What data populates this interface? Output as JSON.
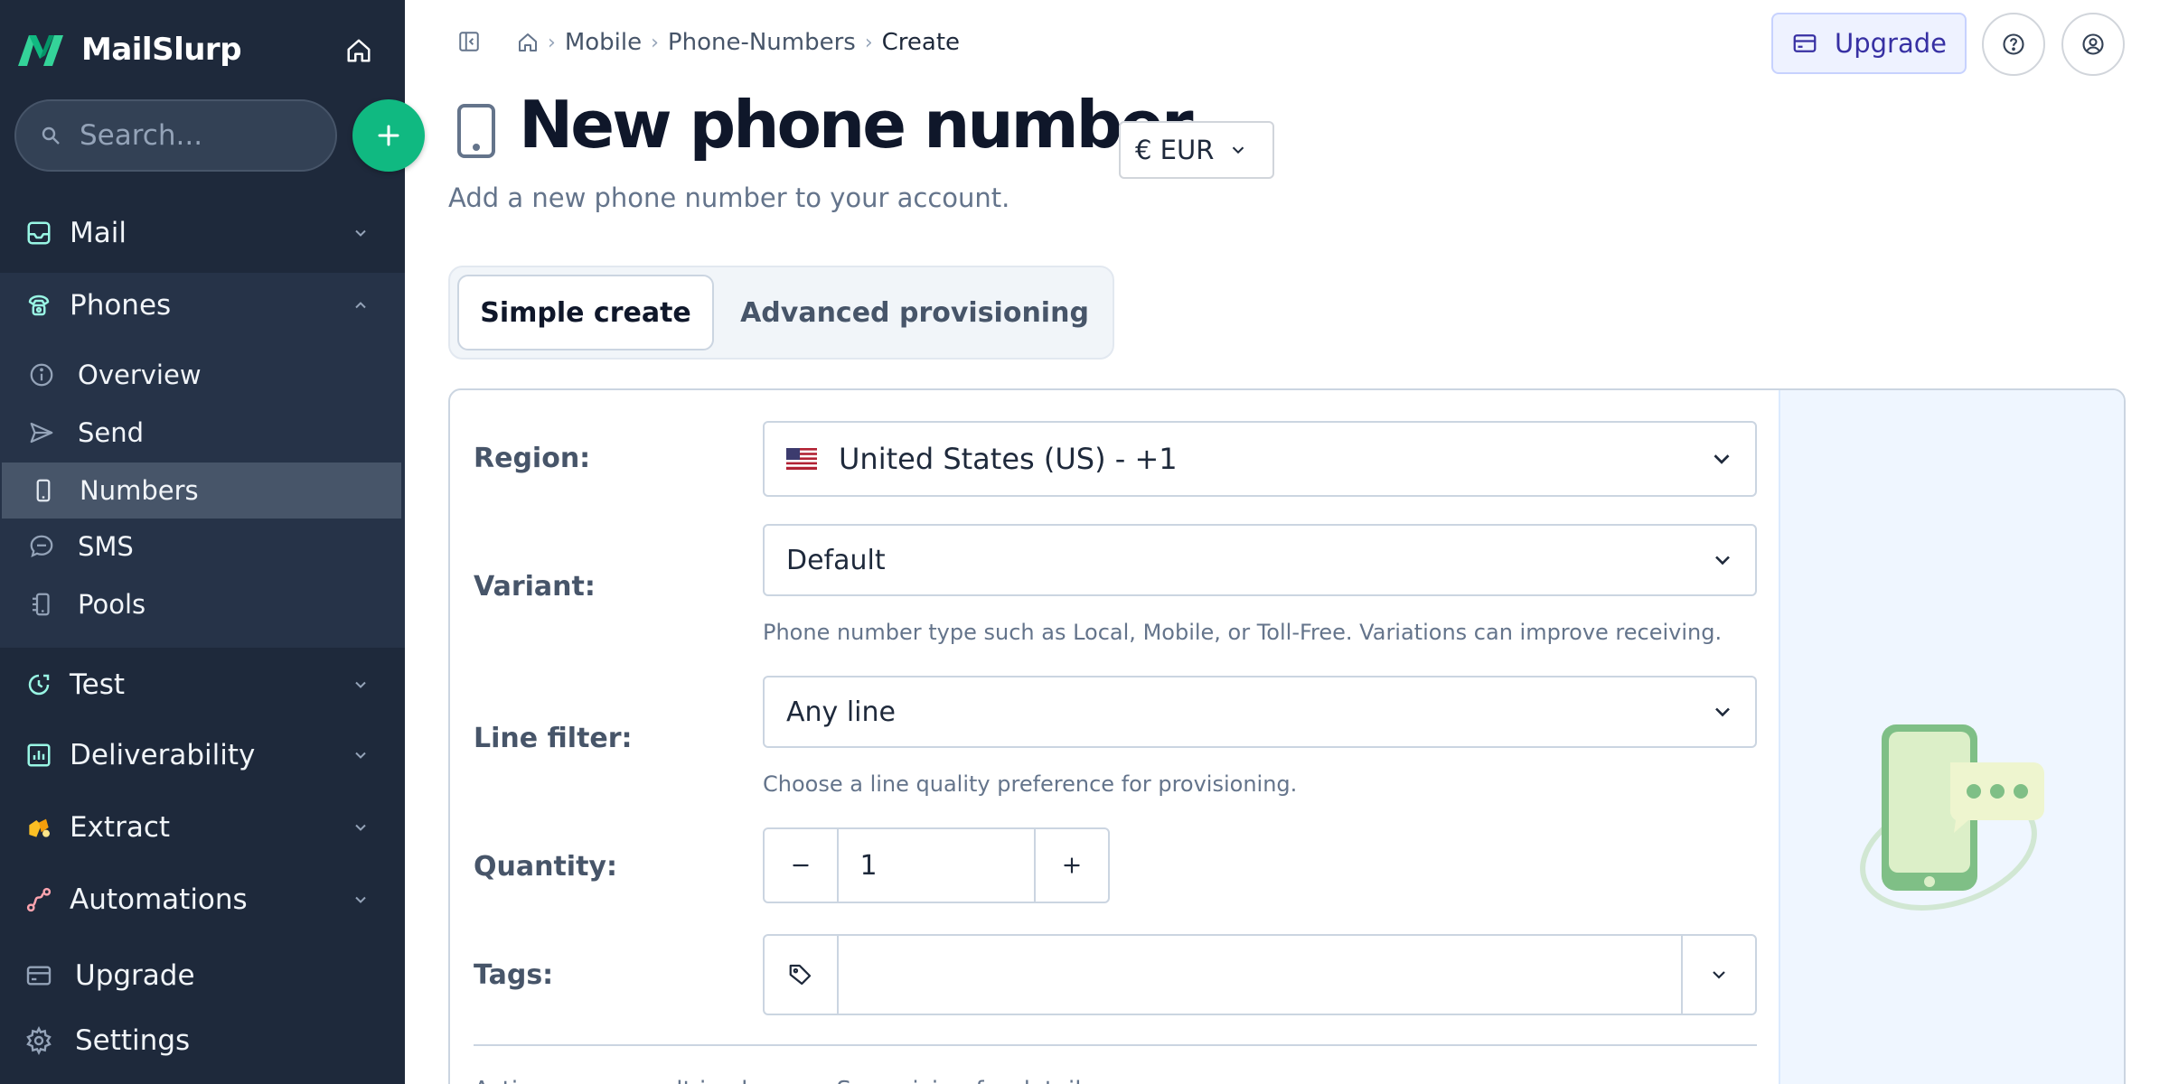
{
  "app": {
    "name": "MailSlurp"
  },
  "sidebar": {
    "search_placeholder": "Search...",
    "nav": {
      "mail": "Mail",
      "phones": "Phones",
      "test": "Test",
      "deliverability": "Deliverability",
      "extract": "Extract",
      "automations": "Automations",
      "upgrade": "Upgrade",
      "settings": "Settings"
    },
    "phones_sub": [
      {
        "label": "Overview",
        "icon": "info-icon"
      },
      {
        "label": "Send",
        "icon": "send-icon"
      },
      {
        "label": "Numbers",
        "icon": "phone-icon",
        "active": true
      },
      {
        "label": "SMS",
        "icon": "chat-icon"
      },
      {
        "label": "Pools",
        "icon": "pool-icon"
      }
    ]
  },
  "topbar": {
    "breadcrumb": [
      "Mobile",
      "Phone-Numbers",
      "Create"
    ],
    "upgrade_label": "Upgrade"
  },
  "header": {
    "title": "New phone number",
    "currency": "€ EUR",
    "subtitle": "Add a new phone number to your account."
  },
  "tabs": {
    "simple": "Simple create",
    "advanced": "Advanced provisioning",
    "active": "simple"
  },
  "form": {
    "region_label": "Region:",
    "region_value": "United States (US) - +1",
    "variant_label": "Variant:",
    "variant_value": "Default",
    "variant_help": "Phone number type such as Local, Mobile, or Toll-Free. Variations can improve receiving.",
    "line_label": "Line filter:",
    "line_value": "Any line",
    "line_help": "Choose a line quality preference for provisioning.",
    "quantity_label": "Quantity:",
    "quantity_value": "1",
    "tags_label": "Tags:",
    "tags_value": "",
    "footnote": "Actions may result in charges. See pricing for details."
  },
  "colors": {
    "sidebar_bg": "#1e293b",
    "accent_green": "#10b981",
    "upgrade_text": "#3730a3"
  }
}
